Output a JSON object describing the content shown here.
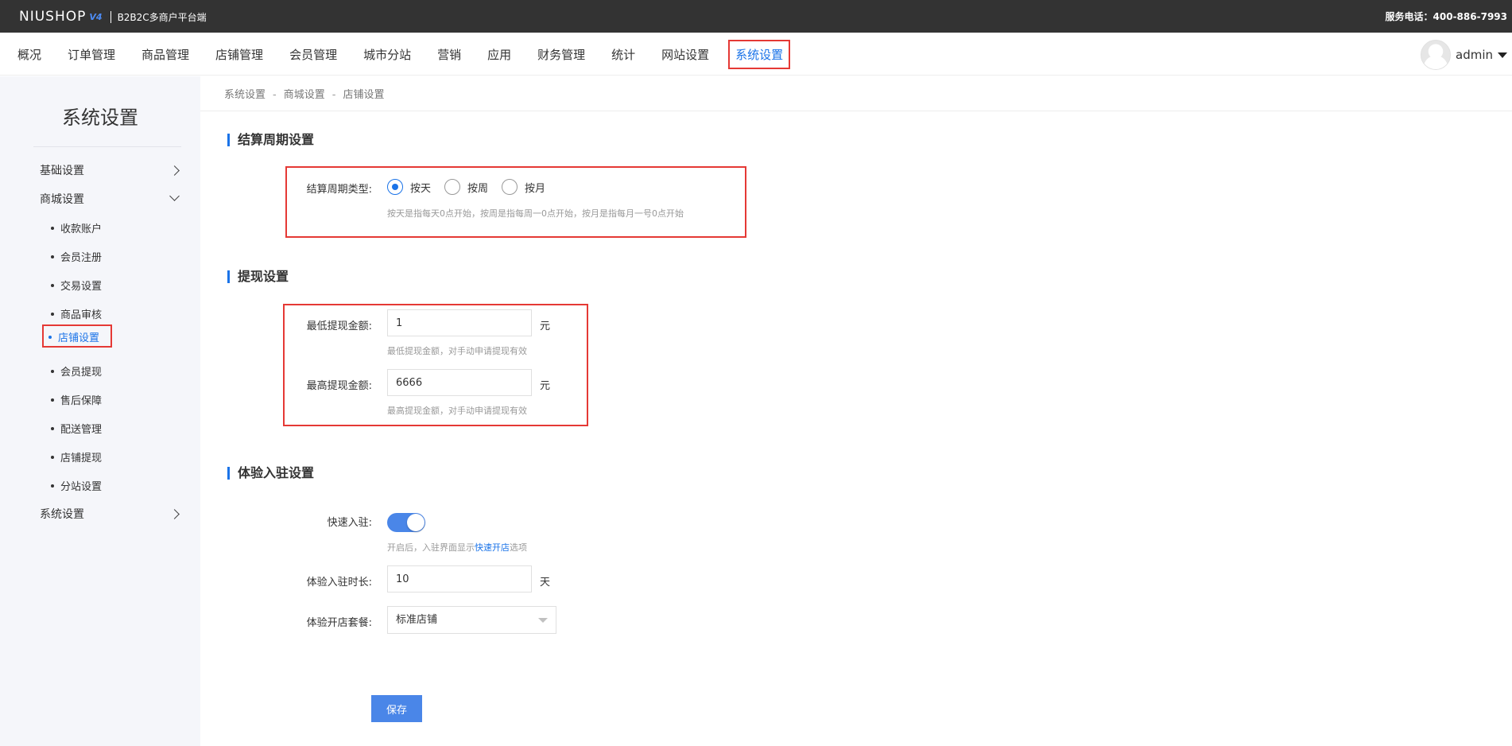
{
  "topbar": {
    "logo": "NIUSHOP",
    "version": "V4",
    "subtitle": "B2B2C多商户平台端",
    "service": "服务电话：400-886-7993"
  },
  "nav": {
    "items": [
      "概况",
      "订单管理",
      "商品管理",
      "店铺管理",
      "会员管理",
      "城市分站",
      "营销",
      "应用",
      "财务管理",
      "统计",
      "网站设置",
      "系统设置"
    ],
    "active": "系统设置",
    "user": "admin"
  },
  "sidebar": {
    "title": "系统设置",
    "groups": [
      "基础设置",
      "商城设置",
      "系统设置"
    ],
    "sub_items": [
      "收款账户",
      "会员注册",
      "交易设置",
      "商品审核",
      "店铺设置",
      "会员提现",
      "售后保障",
      "配送管理",
      "店铺提现",
      "分站设置"
    ],
    "active": "店铺设置"
  },
  "breadcrumb": [
    "系统设置",
    "商城设置",
    "店铺设置"
  ],
  "settlement": {
    "title": "结算周期设置",
    "label": "结算周期类型:",
    "options": [
      "按天",
      "按周",
      "按月"
    ],
    "selected": "按天",
    "hint": "按天是指每天0点开始，按周是指每周一0点开始，按月是指每月一号0点开始"
  },
  "withdraw": {
    "title": "提现设置",
    "min_label": "最低提现金额:",
    "min_value": "1",
    "min_hint": "最低提现金额，对手动申请提现有效",
    "max_label": "最高提现金额:",
    "max_value": "6666",
    "max_hint": "最高提现金额，对手动申请提现有效",
    "unit": "元"
  },
  "trial": {
    "title": "体验入驻设置",
    "quick_label": "快速入驻:",
    "quick_enabled": true,
    "quick_hint_pre": "开启后，入驻界面显示",
    "quick_hint_link": "快速开店",
    "quick_hint_post": "选项",
    "duration_label": "体验入驻时长:",
    "duration_value": "10",
    "duration_unit": "天",
    "package_label": "体验开店套餐:",
    "package_value": "标准店铺"
  },
  "save_label": "保存",
  "colors": {
    "accent": "#1a73e8",
    "highlight": "#e53935",
    "topbar": "#333333"
  }
}
